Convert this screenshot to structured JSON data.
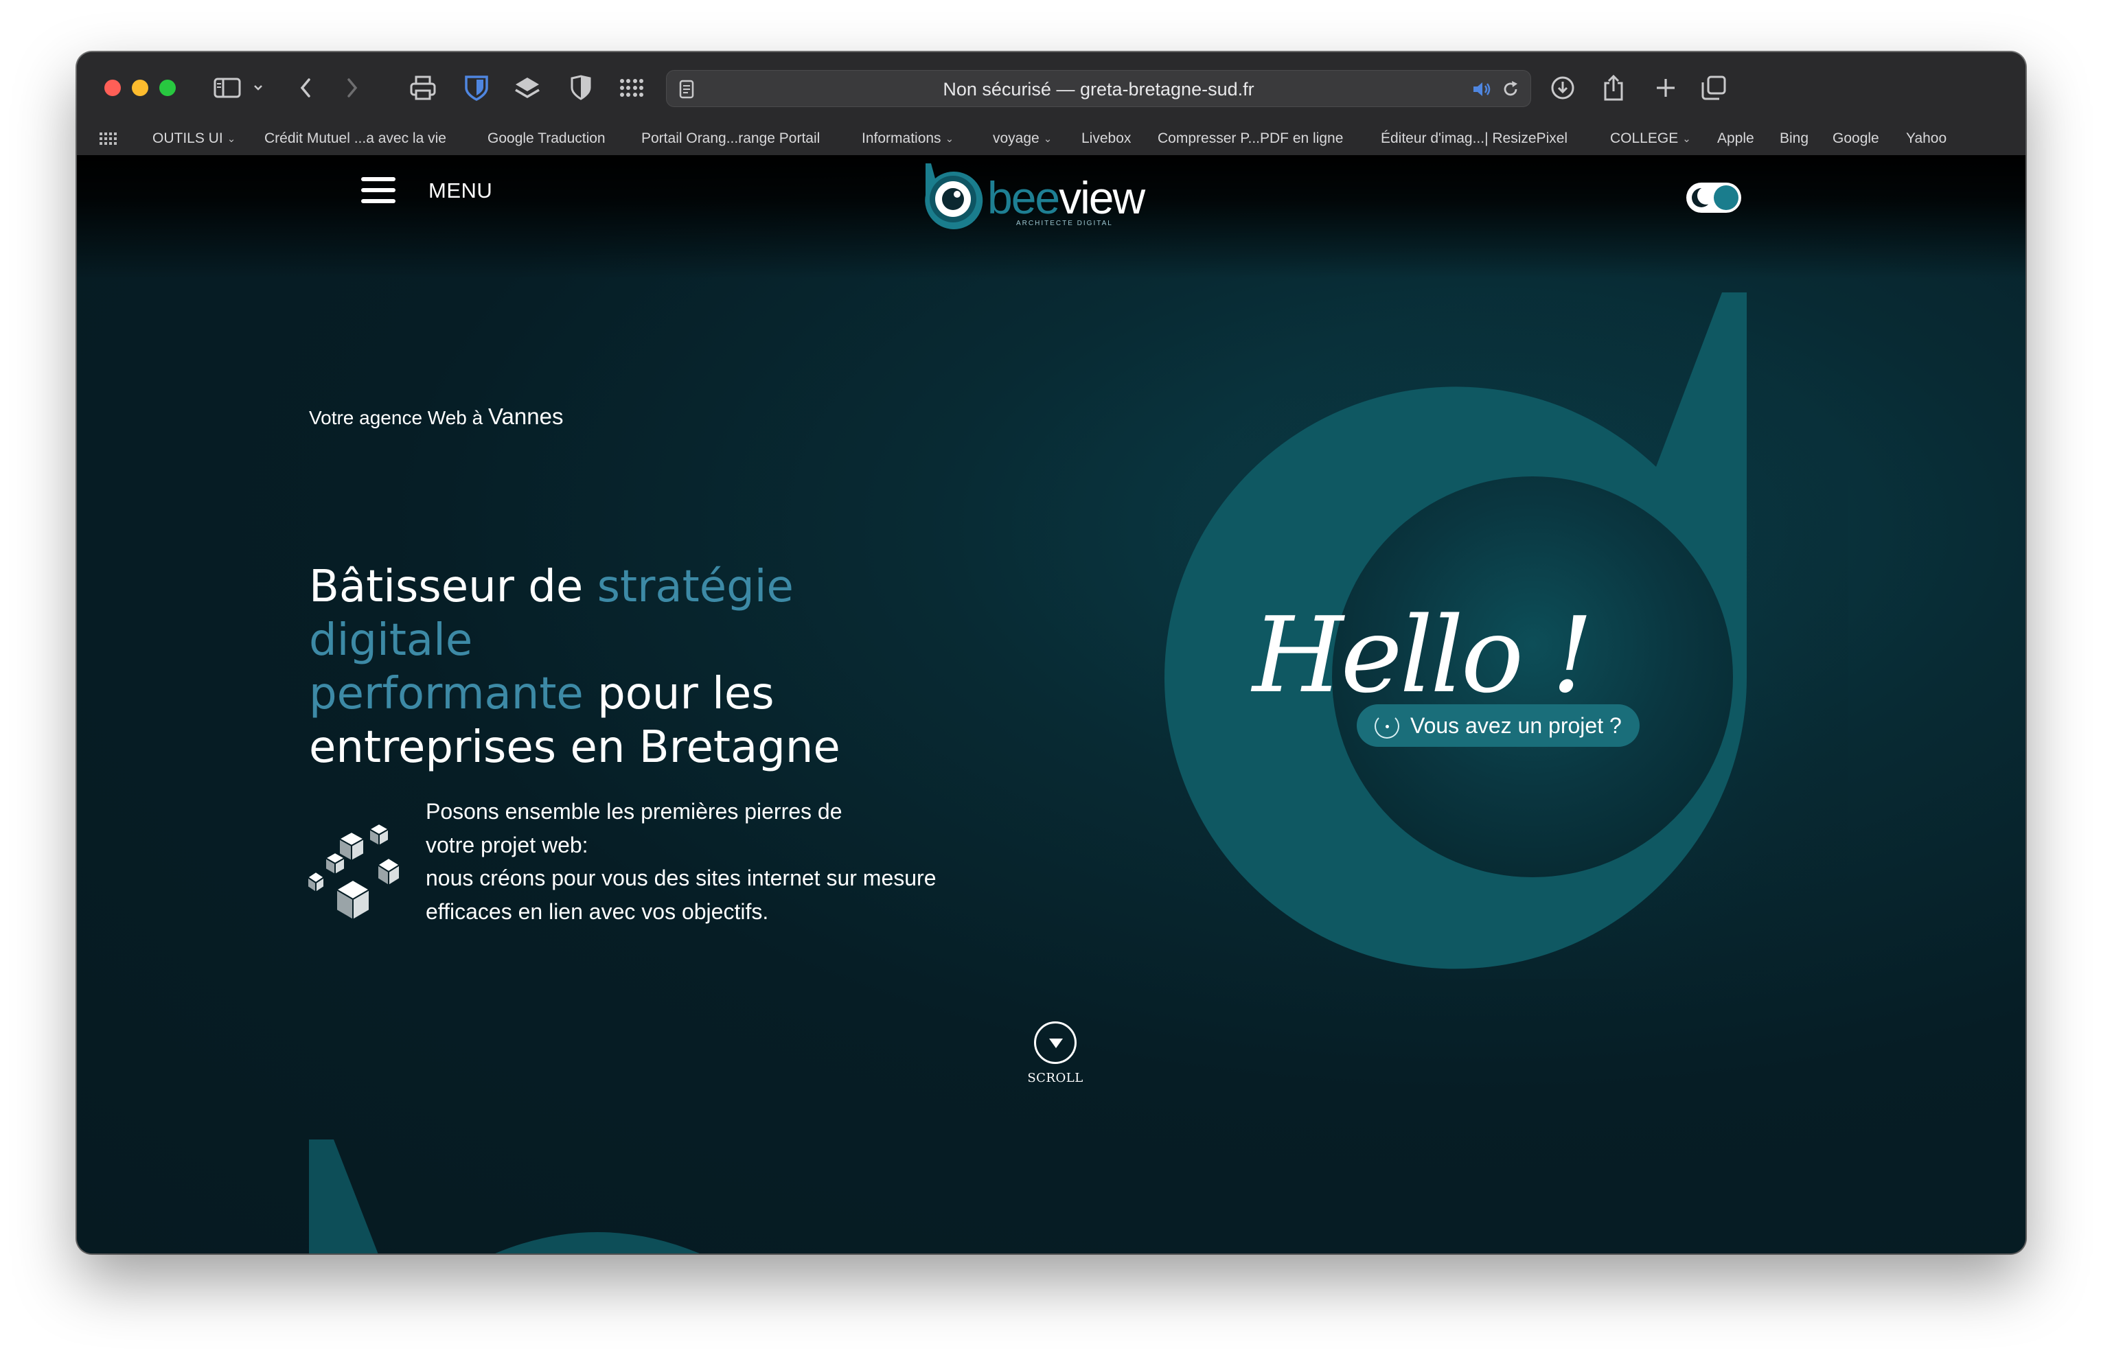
{
  "browser": {
    "url_security": "Non sécurisé",
    "url_separator": " — ",
    "url_host": "greta-bretagne-sud.fr",
    "bookmarks": [
      {
        "label": "OUTILS UI",
        "folder": true
      },
      {
        "label": "Crédit Mutuel ...a avec la vie",
        "folder": false
      },
      {
        "label": "Google Traduction",
        "folder": false
      },
      {
        "label": "Portail Orang...range Portail",
        "folder": false
      },
      {
        "label": "Informations",
        "folder": true
      },
      {
        "label": "voyage",
        "folder": true
      },
      {
        "label": "Livebox",
        "folder": false
      },
      {
        "label": "Compresser P...PDF en ligne",
        "folder": false
      },
      {
        "label": "Éditeur d'imag...| ResizePixel",
        "folder": false
      },
      {
        "label": "COLLEGE",
        "folder": true
      },
      {
        "label": "Apple",
        "folder": false
      },
      {
        "label": "Bing",
        "folder": false
      },
      {
        "label": "Google",
        "folder": false
      },
      {
        "label": "Yahoo",
        "folder": false
      }
    ]
  },
  "site": {
    "menu_label": "MENU",
    "logo": {
      "word_light": "bee",
      "word_dark": "view",
      "subtitle": "ARCHITECTE DIGITAL"
    },
    "tagline_prefix": "Votre agence Web à ",
    "tagline_city": "Vannes",
    "headline": {
      "part1": "Bâtisseur de ",
      "accent1": "stratégie digitale",
      "accent2": "performante",
      "part2": " pour les",
      "part3": "entreprises en Bretagne"
    },
    "pitch": [
      "Posons ensemble les premières pierres de",
      "votre projet web:",
      "nous créons pour vous des sites internet sur mesure",
      "efficaces en lien avec vos objectifs."
    ],
    "hello": "Hello !",
    "project_button": "Vous avez un projet ?",
    "scroll_label": "SCROLL"
  },
  "colors": {
    "background": "#061d25",
    "accent_text": "#3d8aa6",
    "teal": "#0f5862",
    "button": "#1a6e7a"
  }
}
